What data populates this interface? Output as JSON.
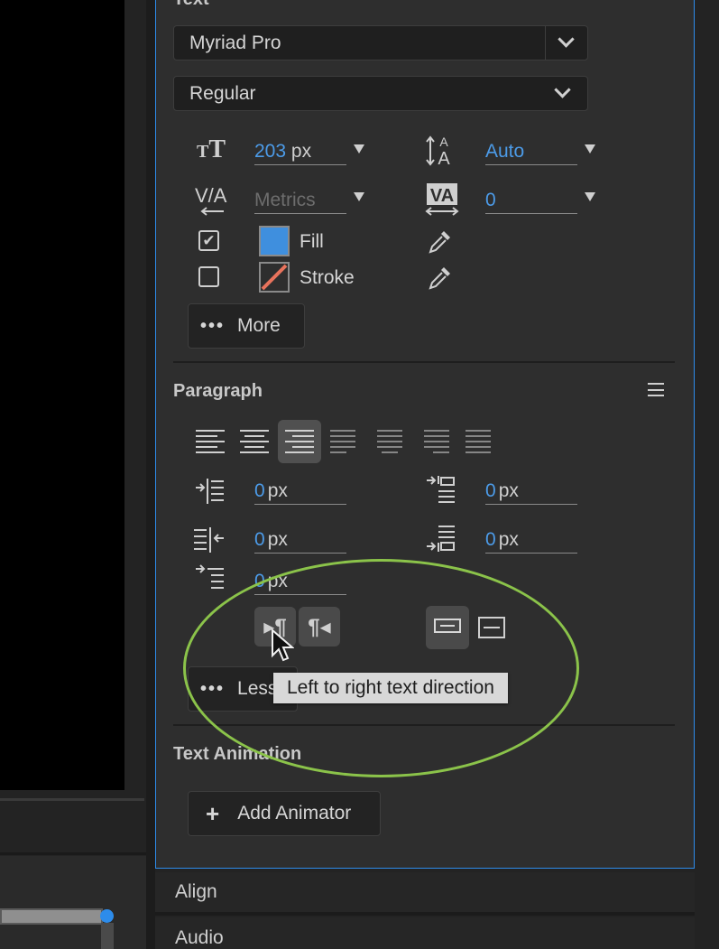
{
  "text_section": {
    "title": "Text",
    "font_family": "Myriad Pro",
    "font_style": "Regular",
    "font_size_value": "203",
    "font_size_unit": "px",
    "leading_value": "Auto",
    "kerning_value": "Metrics",
    "tracking_value": "0",
    "fill_label": "Fill",
    "stroke_label": "Stroke",
    "fill_checked": true,
    "stroke_checked": false,
    "fill_color": "#3f8fde",
    "stroke_color": "#e8735c",
    "more_label": "More",
    "dots": "•••"
  },
  "paragraph": {
    "title": "Paragraph",
    "indent_left_value": "0",
    "indent_right_value": "0",
    "space_before_value": "0",
    "space_after_value": "0",
    "first_line_value": "0",
    "unit": "px",
    "less_label": "Less",
    "dots": "•••",
    "ltr_glyph": "▸¶",
    "rtl_glyph": "¶◂"
  },
  "tooltip": {
    "text": "Left to right text direction"
  },
  "text_animation": {
    "title": "Text Animation",
    "add_label": "Add Animator",
    "plus": "+"
  },
  "tabs": {
    "align": "Align",
    "audio": "Audio"
  },
  "colors": {
    "accent": "#2d8ceb",
    "value_blue": "#4c9be8",
    "highlight_ellipse": "#8bc34a"
  }
}
